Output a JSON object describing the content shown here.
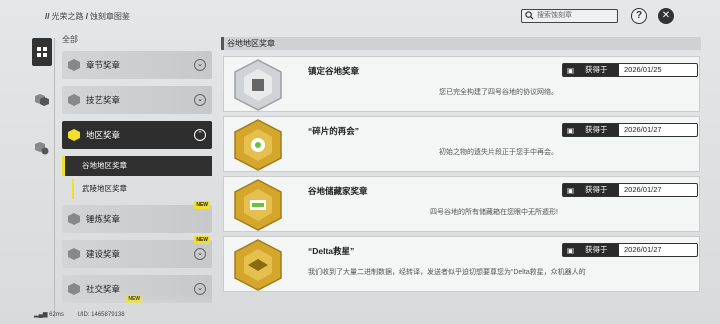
{
  "breadcrumb": {
    "path1": "光荣之路",
    "path2": "蚀刻章图鉴"
  },
  "search": {
    "placeholder": "搜索蚀刻章"
  },
  "sidebar": {
    "all_label": "全部",
    "categories": [
      {
        "label": "章节奖章",
        "new": false
      },
      {
        "label": "技艺奖章",
        "new": false
      },
      {
        "label": "地区奖章",
        "new": false
      },
      {
        "label": "锤炼奖章",
        "new": true
      },
      {
        "label": "建设奖章",
        "new": true
      },
      {
        "label": "社交奖章",
        "new": true
      }
    ],
    "subs": [
      "谷地地区奖章",
      "武陵地区奖章"
    ],
    "new_label": "NEW"
  },
  "main": {
    "section_title": "谷地地区奖章",
    "obtained_label": "获得于",
    "cards": [
      {
        "name": "镇定谷地奖章",
        "desc": "您已完全构建了四号谷地的协议网络。",
        "date": "2026/01/25",
        "medal_color": "silver"
      },
      {
        "name": "“碎片的再会”",
        "desc": "初始之物的遗失片段正于您手中再会。",
        "date": "2026/01/27",
        "medal_color": "gold"
      },
      {
        "name": "谷地储藏家奖章",
        "desc": "四号谷地的所有储藏箱在您眼中无所遁形!",
        "date": "2026/01/27",
        "medal_color": "gold"
      },
      {
        "name": "“Delta救星”",
        "desc": "我们收到了大量二进制数据，经转译，发送者似乎迫切想要尊您为“Delta救星，众机器人的",
        "date": "2026/01/27",
        "medal_color": "gold"
      }
    ]
  },
  "footer": {
    "ping": "62ms",
    "uid": "UID: 1465879138"
  },
  "colors": {
    "accent": "#f1e02a",
    "dark": "#2e2e2e",
    "gold": "#d4a72c"
  }
}
